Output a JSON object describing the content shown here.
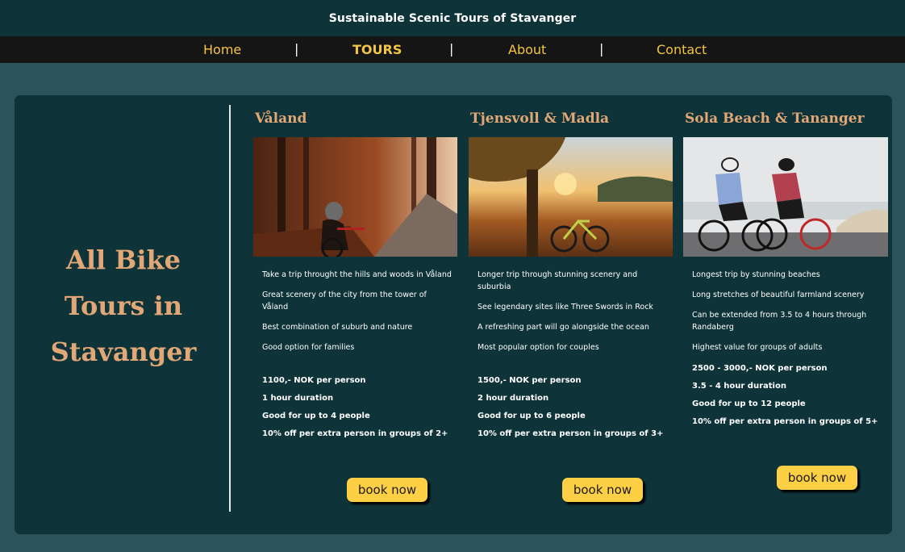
{
  "header": {
    "title": "Sustainable Scenic Tours of Stavanger"
  },
  "nav": {
    "items": [
      {
        "label": "Home"
      },
      {
        "label": "TOURS"
      },
      {
        "label": "About"
      },
      {
        "label": "Contact"
      }
    ],
    "separator": "|"
  },
  "hero": {
    "title": "All Bike Tours in Stavanger"
  },
  "tours": [
    {
      "name": "Våland",
      "features": [
        "Take a trip throught the hills and woods in Våland",
        "Great scenery of the city from the tower of Våland",
        "Best combination of suburb and nature",
        "Good option for families"
      ],
      "details": [
        "1100,- NOK per person",
        "1 hour duration",
        "Good for up to 4 people",
        "10% off per extra person in groups of 2+"
      ],
      "button": "book now"
    },
    {
      "name": "Tjensvoll & Madla",
      "features": [
        "Longer trip through stunning scenery and suburbia",
        "See legendary sites like Three Swords in Rock",
        "A refreshing part will go alongside the ocean",
        "Most popular option for couples"
      ],
      "details": [
        "1500,- NOK per person",
        "2 hour duration",
        "Good for up to 6 people",
        "10% off per extra person in groups of 3+"
      ],
      "button": "book now"
    },
    {
      "name": "Sola Beach & Tananger",
      "features": [
        "Longest trip by stunning beaches",
        "Long stretches of beautiful farmland scenery",
        "Can be extended from 3.5 to 4 hours through Randaberg",
        "Highest value for groups of adults"
      ],
      "details": [
        "2500 - 3000,- NOK per person",
        "3.5 - 4 hour duration",
        "Good for up to 12 people",
        "10% off per extra person in groups of 5+"
      ],
      "button": "book now"
    }
  ],
  "colors": {
    "page_background": "#2b535a",
    "panel_background": "#0e3338",
    "nav_background": "#151515",
    "nav_link": "#f4c542",
    "heading_accent": "#e2a777",
    "button_background": "#fccf45"
  }
}
